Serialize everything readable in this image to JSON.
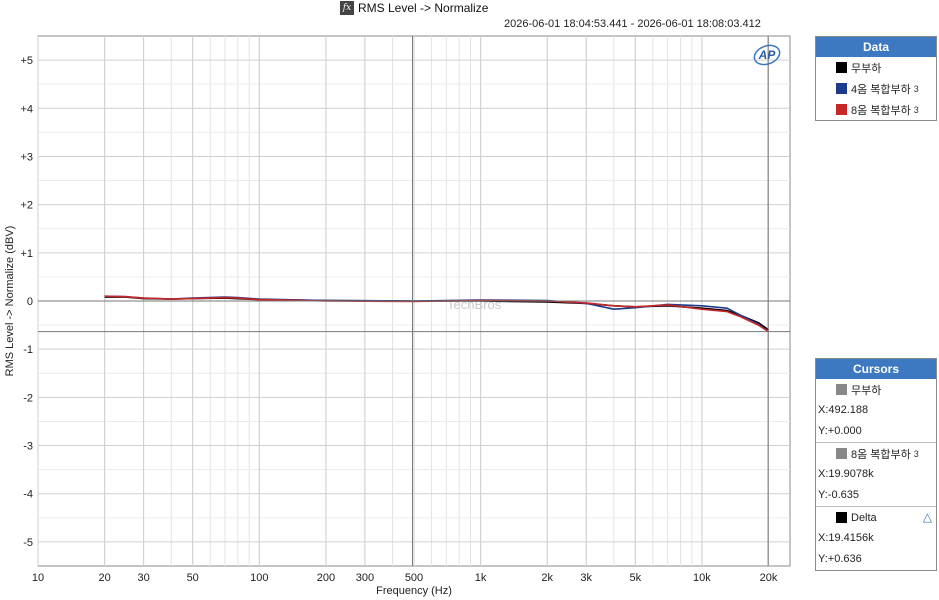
{
  "header": {
    "title": "RMS Level -> Normalize",
    "fx_icon": "function-icon",
    "timestamp": "2026-06-01 18:04:53.441 - 2026-06-01 18:08:03.412",
    "logo_text": "AP"
  },
  "watermark": "TechBros",
  "legend": {
    "title": "Data",
    "items": [
      {
        "label": "무부하",
        "color": "#000000",
        "sup": ""
      },
      {
        "label": "4옴 복합부하",
        "color": "#1f3a8a",
        "sup": "3"
      },
      {
        "label": "8옴 복합부하",
        "color": "#c62828",
        "sup": "3"
      }
    ]
  },
  "cursors": {
    "title": "Cursors",
    "c1": {
      "name": "무부하",
      "x": "X:492.188",
      "y": "Y:+0.000",
      "color": "#888888"
    },
    "c2": {
      "name": "8옴 복합부하",
      "sup": "3",
      "x": "X:19.9078k",
      "y": "Y:-0.635",
      "color": "#888888"
    },
    "delta": {
      "name": "Delta",
      "x": "X:19.4156k",
      "y": "Y:+0.636",
      "color": "#000000",
      "icon": "delta-triangle-icon"
    }
  },
  "chart_data": {
    "type": "line",
    "xlabel": "Frequency (Hz)",
    "ylabel": "RMS Level -> Normalize (dBV)",
    "xscale": "log",
    "xlim": [
      10,
      25000
    ],
    "ylim": [
      -5.5,
      5.5
    ],
    "grid": true,
    "legend_position": "right",
    "x_ticks": [
      {
        "v": 10,
        "l": "10"
      },
      {
        "v": 20,
        "l": "20"
      },
      {
        "v": 30,
        "l": "30"
      },
      {
        "v": 50,
        "l": "50"
      },
      {
        "v": 100,
        "l": "100"
      },
      {
        "v": 200,
        "l": "200"
      },
      {
        "v": 300,
        "l": "300"
      },
      {
        "v": 500,
        "l": "500"
      },
      {
        "v": 1000,
        "l": "1k"
      },
      {
        "v": 2000,
        "l": "2k"
      },
      {
        "v": 3000,
        "l": "3k"
      },
      {
        "v": 5000,
        "l": "5k"
      },
      {
        "v": 10000,
        "l": "10k"
      },
      {
        "v": 20000,
        "l": "20k"
      }
    ],
    "y_ticks": [
      {
        "v": 5,
        "l": "+5"
      },
      {
        "v": 4,
        "l": "+4"
      },
      {
        "v": 3,
        "l": "+3"
      },
      {
        "v": 2,
        "l": "+2"
      },
      {
        "v": 1,
        "l": "+1"
      },
      {
        "v": 0,
        "l": "0"
      },
      {
        "v": -1,
        "l": "-1"
      },
      {
        "v": -2,
        "l": "-2"
      },
      {
        "v": -3,
        "l": "-3"
      },
      {
        "v": -4,
        "l": "-4"
      },
      {
        "v": -5,
        "l": "-5"
      }
    ],
    "series": [
      {
        "name": "무부하",
        "color": "#000000",
        "points": [
          [
            20,
            0.08
          ],
          [
            25,
            0.08
          ],
          [
            30,
            0.05
          ],
          [
            40,
            0.04
          ],
          [
            50,
            0.05
          ],
          [
            70,
            0.06
          ],
          [
            100,
            0.03
          ],
          [
            200,
            0.01
          ],
          [
            500,
            0.0
          ],
          [
            1000,
            0.0
          ],
          [
            2000,
            -0.02
          ],
          [
            3000,
            -0.05
          ],
          [
            4000,
            -0.1
          ],
          [
            5000,
            -0.12
          ],
          [
            7000,
            -0.1
          ],
          [
            10000,
            -0.15
          ],
          [
            13000,
            -0.2
          ],
          [
            15000,
            -0.3
          ],
          [
            18000,
            -0.45
          ],
          [
            20000,
            -0.6
          ]
        ]
      },
      {
        "name": "4옴 복합부하",
        "color": "#1f3a8a",
        "points": [
          [
            20,
            0.1
          ],
          [
            25,
            0.09
          ],
          [
            30,
            0.06
          ],
          [
            40,
            0.04
          ],
          [
            50,
            0.06
          ],
          [
            70,
            0.08
          ],
          [
            80,
            0.07
          ],
          [
            100,
            0.04
          ],
          [
            200,
            0.01
          ],
          [
            500,
            0.0
          ],
          [
            1000,
            0.02
          ],
          [
            2000,
            0.01
          ],
          [
            3000,
            -0.05
          ],
          [
            4000,
            -0.17
          ],
          [
            5000,
            -0.14
          ],
          [
            7000,
            -0.07
          ],
          [
            10000,
            -0.1
          ],
          [
            13000,
            -0.15
          ],
          [
            15000,
            -0.3
          ],
          [
            18000,
            -0.48
          ],
          [
            20000,
            -0.64
          ]
        ]
      },
      {
        "name": "8옴 복합부하",
        "color": "#c62828",
        "points": [
          [
            20,
            0.1
          ],
          [
            25,
            0.09
          ],
          [
            30,
            0.06
          ],
          [
            40,
            0.04
          ],
          [
            50,
            0.05
          ],
          [
            70,
            0.07
          ],
          [
            80,
            0.06
          ],
          [
            100,
            0.03
          ],
          [
            200,
            0.0
          ],
          [
            500,
            -0.01
          ],
          [
            1000,
            0.01
          ],
          [
            2000,
            0.0
          ],
          [
            3000,
            -0.04
          ],
          [
            4000,
            -0.1
          ],
          [
            5000,
            -0.12
          ],
          [
            7000,
            -0.08
          ],
          [
            10000,
            -0.17
          ],
          [
            13000,
            -0.22
          ],
          [
            15000,
            -0.33
          ],
          [
            18000,
            -0.5
          ],
          [
            20000,
            -0.635
          ]
        ]
      }
    ],
    "cursors": [
      {
        "x": 492.188,
        "y": 0.0
      },
      {
        "x": 19907.8,
        "y": -0.635
      }
    ]
  }
}
